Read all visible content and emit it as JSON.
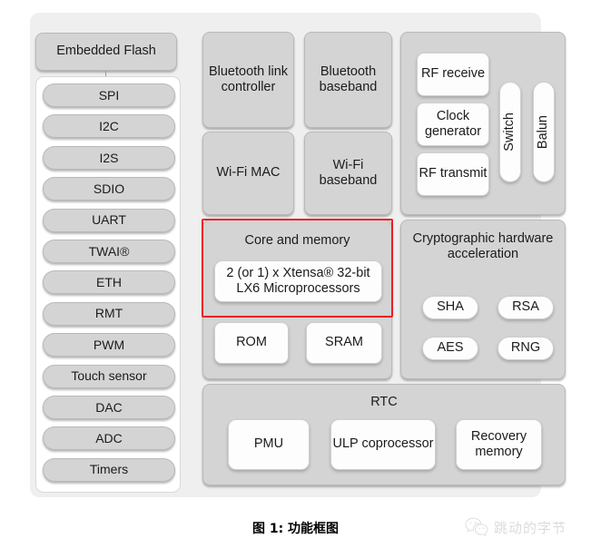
{
  "diagram": {
    "embedded_flash": {
      "label": "Embedded Flash"
    },
    "peripherals": [
      {
        "label": "SPI"
      },
      {
        "label": "I2C"
      },
      {
        "label": "I2S"
      },
      {
        "label": "SDIO"
      },
      {
        "label": "UART"
      },
      {
        "label": "TWAI®"
      },
      {
        "label": "ETH"
      },
      {
        "label": "RMT"
      },
      {
        "label": "PWM"
      },
      {
        "label": "Touch sensor"
      },
      {
        "label": "DAC"
      },
      {
        "label": "ADC"
      },
      {
        "label": "Timers"
      }
    ],
    "radio": {
      "bluetooth_link_controller": "Bluetooth link controller",
      "bluetooth_baseband": "Bluetooth baseband",
      "wifi_mac": "Wi-Fi MAC",
      "wifi_baseband": "Wi-Fi baseband"
    },
    "rf": {
      "rf_receive": "RF receive",
      "clock_generator": "Clock generator",
      "rf_transmit": "RF transmit",
      "switch": "Switch",
      "balun": "Balun"
    },
    "core": {
      "title": "Core and memory",
      "processor": "2 (or 1) x Xtensa® 32-bit LX6 Microprocessors",
      "rom": "ROM",
      "sram": "SRAM",
      "highlight_color": "#ef1c23"
    },
    "crypto": {
      "title": "Cryptographic hardware acceleration",
      "blocks": [
        {
          "label": "SHA"
        },
        {
          "label": "RSA"
        },
        {
          "label": "AES"
        },
        {
          "label": "RNG"
        }
      ]
    },
    "rtc": {
      "title": "RTC",
      "pmu": "PMU",
      "ulp_coprocessor": "ULP coprocessor",
      "recovery_memory": "Recovery memory"
    }
  },
  "caption": {
    "text": "图 1: 功能框图"
  },
  "watermark": {
    "text": "跳动的字节",
    "icon": "wechat-icon"
  }
}
